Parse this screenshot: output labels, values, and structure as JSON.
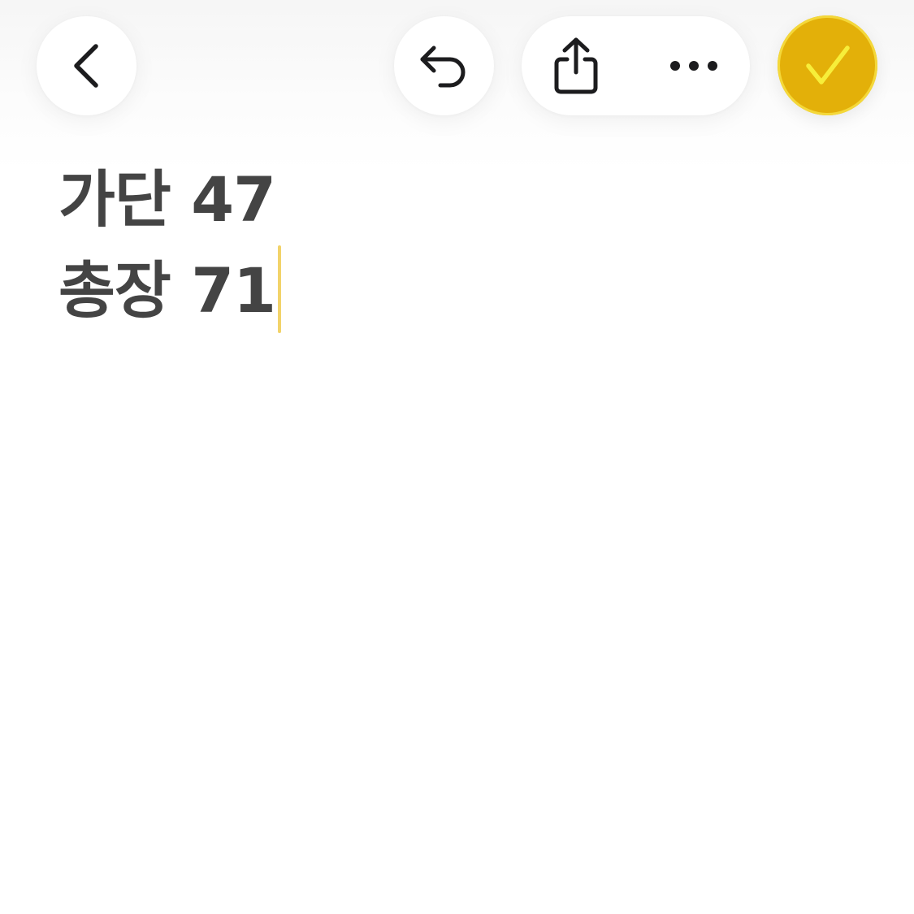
{
  "toolbar": {
    "back_icon": "chevron-left-icon",
    "undo_icon": "undo-icon",
    "share_icon": "share-icon",
    "more_icon": "ellipsis-icon",
    "done_icon": "checkmark-icon"
  },
  "colors": {
    "accent": "#e3b009",
    "accent_ring": "#f4d83a",
    "check": "#f7ee3a",
    "text": "#444444",
    "icon": "#1c1c1e",
    "caret": "#f2d36a"
  },
  "note": {
    "lines": [
      "가단 47",
      "총장 71"
    ]
  }
}
